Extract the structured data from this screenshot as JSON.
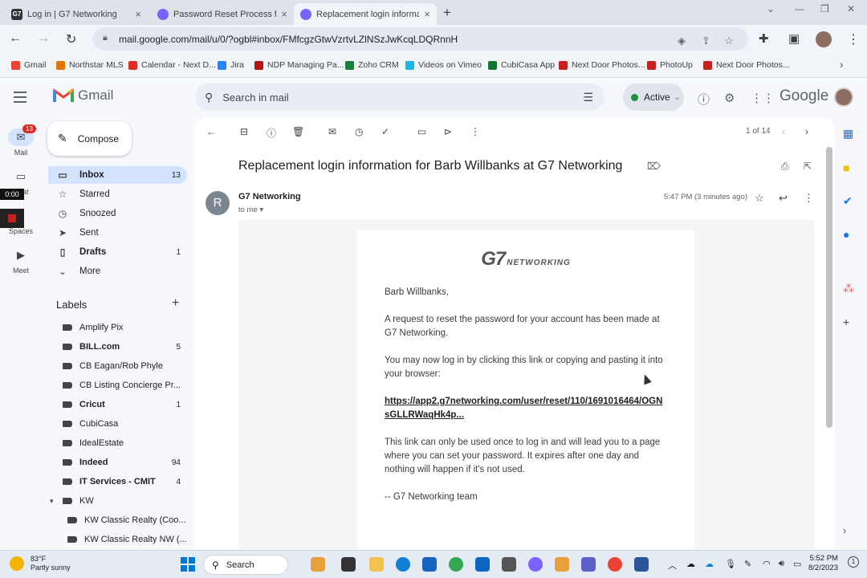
{
  "browser": {
    "tabs": [
      {
        "title": "Log in | G7 Networking",
        "favicon": "G7",
        "color": "#333333",
        "active": false
      },
      {
        "title": "Password Reset Process for Cli",
        "favicon": "",
        "color": "#7b61ff",
        "active": false
      },
      {
        "title": "Replacement login information",
        "favicon": "",
        "color": "#7b61ff",
        "active": true
      }
    ],
    "url": "mail.google.com/mail/u/0/?ogbl#inbox/FMfcgzGtwVzrtvLZlNSzJwKcqLDQRnnH",
    "bookmarks": [
      {
        "label": "Gmail",
        "color": "#ea4335"
      },
      {
        "label": "Northstar MLS",
        "color": "#e37400"
      },
      {
        "label": "Calendar - Next D...",
        "color": "#d93025"
      },
      {
        "label": "Jira",
        "color": "#2684ff"
      },
      {
        "label": "NDP Managing Pa...",
        "color": "#b31412"
      },
      {
        "label": "Zoho CRM",
        "color": "#188038"
      },
      {
        "label": "Videos on Vimeo",
        "color": "#1ab7ea"
      },
      {
        "label": "CubiCasa App",
        "color": "#137333"
      },
      {
        "label": "Next Door Photos...",
        "color": "#c5221f"
      },
      {
        "label": "PhotoUp",
        "color": "#c5221f"
      },
      {
        "label": "Next Door Photos...",
        "color": "#c5221f"
      }
    ]
  },
  "gmail": {
    "app_name": "Gmail",
    "search_placeholder": "Search in mail",
    "status": "Active",
    "brand_text": "Google",
    "rail": {
      "mail_label": "Mail",
      "mail_badge": "13",
      "chat_label": "Chat",
      "spaces_label": "Spaces",
      "meet_label": "Meet",
      "recording_time": "0:00"
    },
    "compose_label": "Compose",
    "nav": [
      {
        "label": "Inbox",
        "count": "13",
        "icon": "inbox-icon",
        "glyph": "▭",
        "selected": true,
        "bold": true
      },
      {
        "label": "Starred",
        "count": "",
        "icon": "star-icon",
        "glyph": "☆",
        "selected": false,
        "bold": false
      },
      {
        "label": "Snoozed",
        "count": "",
        "icon": "clock-icon",
        "glyph": "◷",
        "selected": false,
        "bold": false
      },
      {
        "label": "Sent",
        "count": "",
        "icon": "send-icon",
        "glyph": "➤",
        "selected": false,
        "bold": false
      },
      {
        "label": "Drafts",
        "count": "1",
        "icon": "draft-icon",
        "glyph": "▯",
        "selected": false,
        "bold": true
      },
      {
        "label": "More",
        "count": "",
        "icon": "chevron-down-icon",
        "glyph": "⌄",
        "selected": false,
        "bold": false
      }
    ],
    "labels_title": "Labels",
    "labels": [
      {
        "label": "Amplify Pix",
        "count": "",
        "bold": false
      },
      {
        "label": "BILL.com",
        "count": "5",
        "bold": true
      },
      {
        "label": "CB Eagan/Rob Phyle",
        "count": "",
        "bold": false
      },
      {
        "label": "CB Listing Concierge Pr...",
        "count": "",
        "bold": false
      },
      {
        "label": "Cricut",
        "count": "1",
        "bold": true
      },
      {
        "label": "CubiCasa",
        "count": "",
        "bold": false
      },
      {
        "label": "IdealEstate",
        "count": "",
        "bold": false
      },
      {
        "label": "Indeed",
        "count": "94",
        "bold": true
      },
      {
        "label": "IT Services - CMIT",
        "count": "4",
        "bold": true
      },
      {
        "label": "KW",
        "count": "",
        "bold": false
      },
      {
        "label": "KW Classic Realty (Coo...",
        "count": "",
        "bold": false
      },
      {
        "label": "KW Classic Realty NW (...",
        "count": "",
        "bold": false
      }
    ],
    "pager": "1 of 14",
    "message": {
      "subject": "Replacement login information for Barb Willbanks at G7 Networking",
      "sender_initial": "R",
      "sender": "G7 Networking",
      "to": "to me",
      "time": "5:47 PM (3 minutes ago)",
      "logo_g7": "G7",
      "logo_net": "NETWORKING",
      "greeting": "Barb Willbanks,",
      "para1": "A request to reset the password for your account has been made at G7 Networking.",
      "para2": "You may now log in by clicking this link or copying and pasting it into your browser:",
      "link": "https://app2.g7networking.com/user/reset/110/1691016464/OGNsGLLRWaqHk4p...",
      "para3": "This link can only be used once to log in and will lead you to a page where you can set your password. It expires after one day and nothing will happen if it's not used.",
      "signoff": "-- G7 Networking team"
    }
  },
  "taskbar": {
    "temperature": "83°F",
    "weather": "Partly sunny",
    "search_label": "Search",
    "time": "5:52 PM",
    "date": "8/2/2023"
  }
}
